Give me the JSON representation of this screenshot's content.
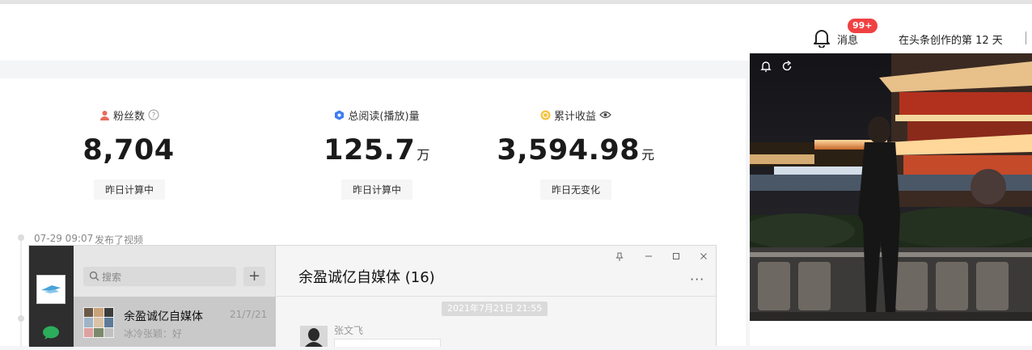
{
  "header": {
    "notification_badge": "99+",
    "messages_label": "消息",
    "creation_days": "在头条创作的第 12 天"
  },
  "stats": [
    {
      "label": "粉丝数",
      "value": "8,704",
      "unit": "",
      "sub": "昨日计算中",
      "icon": "user-icon",
      "icon_color": "#e86b5c"
    },
    {
      "label": "总阅读(播放)量",
      "value": "125.7",
      "unit": "万",
      "sub": "昨日计算中",
      "icon": "read-icon",
      "icon_color": "#3d7cf0"
    },
    {
      "label": "累计收益",
      "value": "3,594.98",
      "unit": "元",
      "sub": "昨日无变化",
      "icon": "coin-icon",
      "icon_color": "#f5c441"
    }
  ],
  "activity": {
    "time": "07-29 09:07",
    "text": "发布了视频"
  },
  "wechat": {
    "search_placeholder": "搜索",
    "chat_name": "余盈诚亿自媒体",
    "chat_time": "21/7/21",
    "chat_preview": "冰冷张颖：好",
    "window_title": "余盈诚亿自媒体 (16)",
    "date_stamp": "2021年7月21日 21:55",
    "sender_name": "张文飞"
  },
  "colors": {
    "accent_red": "#f04142",
    "wechat_green": "#2bad5b",
    "wechat_dark": "#2e2e2e"
  }
}
